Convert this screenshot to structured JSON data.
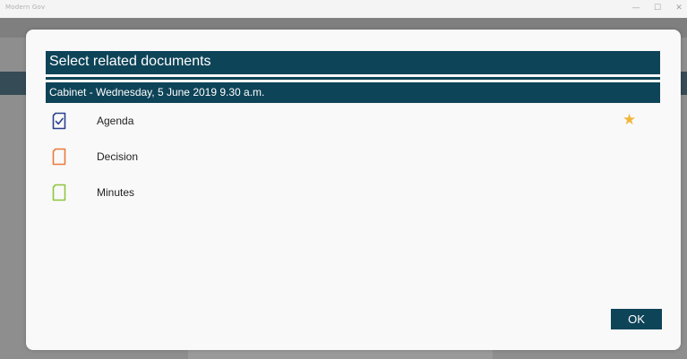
{
  "window": {
    "app_title": "Modern Gov",
    "controls": [
      "—",
      "☐",
      "✕"
    ]
  },
  "dialog": {
    "title": "Select related documents",
    "meeting": "Cabinet - Wednesday, 5 June 2019 9.30 a.m.",
    "documents": [
      {
        "label": "Agenda",
        "icon": "agenda-icon",
        "color": "#2a3f8f",
        "starred": true
      },
      {
        "label": "Decision",
        "icon": "decision-icon",
        "color": "#ea7a3c",
        "starred": false
      },
      {
        "label": "Minutes",
        "icon": "minutes-icon",
        "color": "#8ec63f",
        "starred": false
      }
    ],
    "ok_label": "OK"
  },
  "colors": {
    "header_navy": "#0e4458",
    "star": "#f2b63c",
    "overlay": "#8c8c8c"
  }
}
